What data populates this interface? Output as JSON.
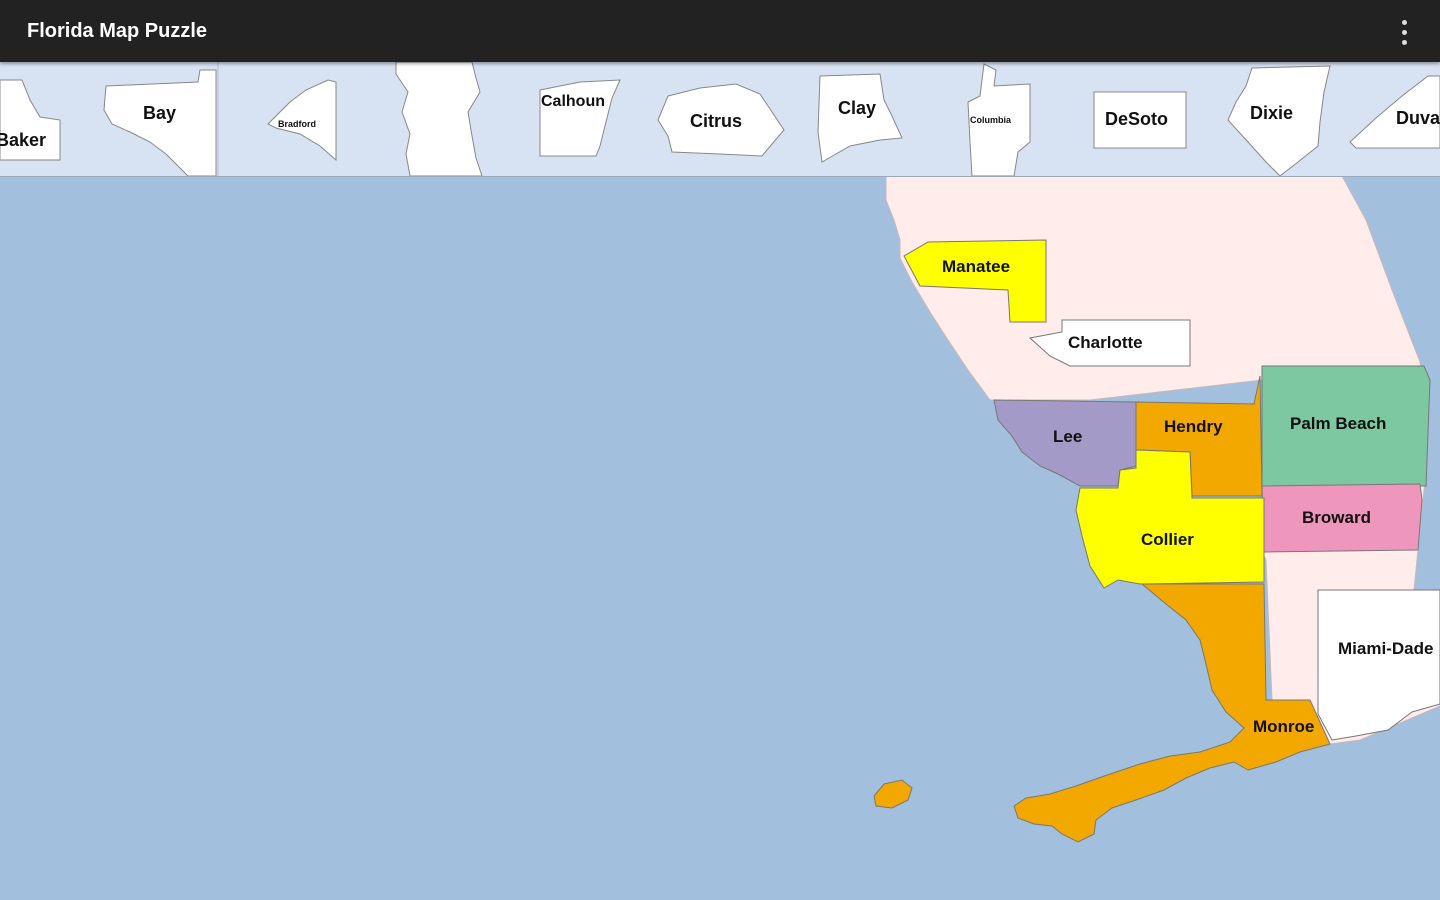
{
  "app": {
    "title": "Florida Map Puzzle",
    "menu_icon": "more-vert-icon"
  },
  "tray": {
    "pieces": [
      {
        "label": "Baker"
      },
      {
        "label": "Bay"
      },
      {
        "label": "Bradford"
      },
      {
        "label": "Calhoun"
      },
      {
        "label": "Citrus"
      },
      {
        "label": "Clay"
      },
      {
        "label": "Columbia"
      },
      {
        "label": "DeSoto"
      },
      {
        "label": "Dixie"
      },
      {
        "label": "Duval"
      }
    ]
  },
  "map": {
    "counties": [
      {
        "label": "Manatee",
        "color": "#ffff00"
      },
      {
        "label": "Charlotte",
        "color": "#ffffff"
      },
      {
        "label": "Lee",
        "color": "#a39ac7"
      },
      {
        "label": "Hendry",
        "color": "#f3a800"
      },
      {
        "label": "Palm Beach",
        "color": "#7dc8a1"
      },
      {
        "label": "Broward",
        "color": "#ee96bb"
      },
      {
        "label": "Collier",
        "color": "#ffff00"
      },
      {
        "label": "Miami-Dade",
        "color": "#ffffff"
      },
      {
        "label": "Monroe",
        "color": "#f3a800"
      }
    ]
  },
  "colors": {
    "water": "#a2c0de",
    "land_unplaced": "#ffeceb",
    "tray_background": "#d7e2f2",
    "app_bar": "#222222"
  }
}
